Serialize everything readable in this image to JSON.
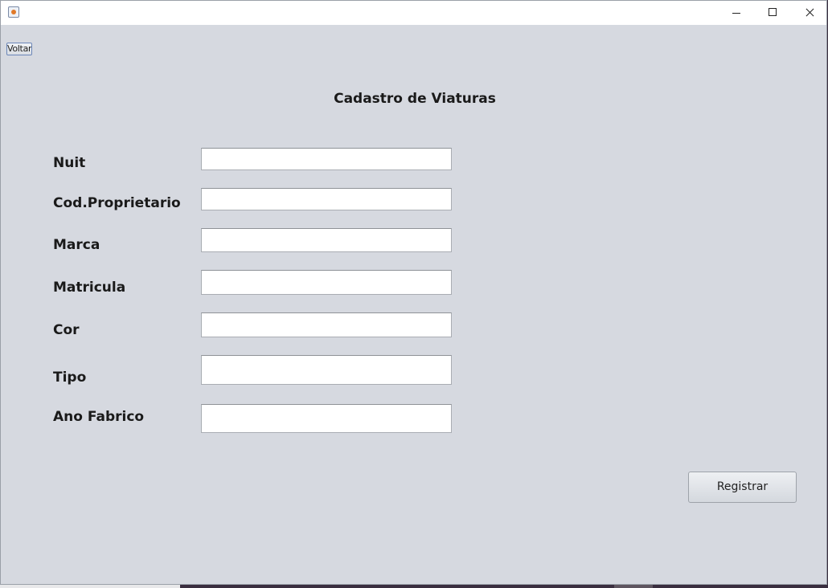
{
  "window": {
    "controls": [
      "minimize-icon",
      "maximize-icon",
      "close-icon"
    ]
  },
  "toolbar": {
    "back_label": "Voltar"
  },
  "form": {
    "title": "Cadastro de Viaturas",
    "fields": [
      {
        "label": "Nuit",
        "value": ""
      },
      {
        "label": "Cod.Proprietario",
        "value": ""
      },
      {
        "label": "Marca",
        "value": ""
      },
      {
        "label": "Matricula",
        "value": ""
      },
      {
        "label": "Cor",
        "value": ""
      },
      {
        "label": "Tipo",
        "value": ""
      },
      {
        "label": "Ano Fabrico",
        "value": ""
      }
    ],
    "submit_label": "Registrar"
  }
}
